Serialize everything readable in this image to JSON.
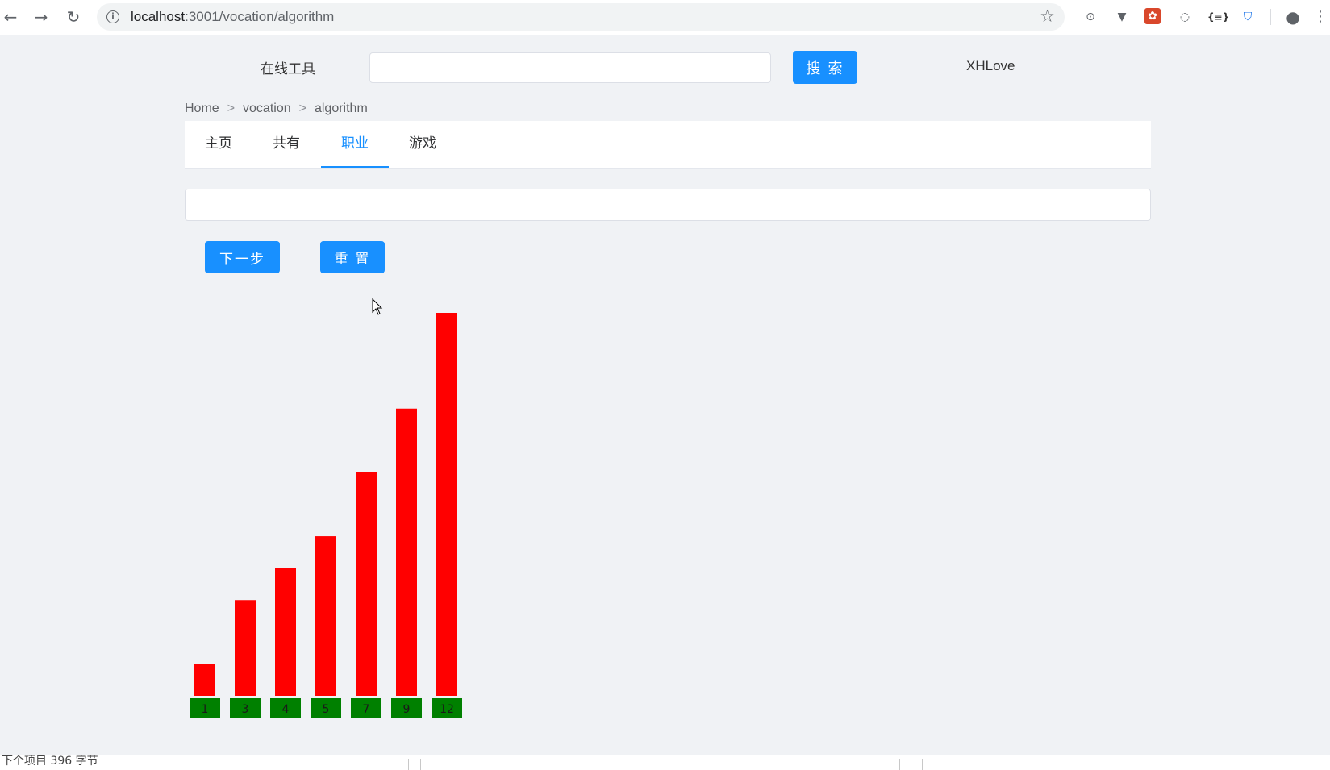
{
  "browser": {
    "url_host": "localhost",
    "url_rest": ":3001/vocation/algorithm",
    "icons": [
      "back-icon",
      "forward-icon",
      "reload-icon",
      "info-icon",
      "star-icon",
      "extension-icons",
      "profile-icon",
      "menu-icon"
    ]
  },
  "header": {
    "brand": "在线工具",
    "search_placeholder": "",
    "search_button": "搜 索",
    "user": "XHLove"
  },
  "breadcrumb": [
    "Home",
    "vocation",
    "algorithm"
  ],
  "breadcrumb_separator": ">",
  "tabs": [
    {
      "label": "主页",
      "active": false
    },
    {
      "label": "共有",
      "active": false
    },
    {
      "label": "职业",
      "active": true
    },
    {
      "label": "游戏",
      "active": false
    }
  ],
  "controls": {
    "input_value": "",
    "next_button": "下一步",
    "reset_button": "重 置"
  },
  "colors": {
    "primary": "#1890ff",
    "bar": "#ff0000",
    "label_box": "#008000"
  },
  "chart_data": {
    "type": "bar",
    "categories": [
      "1",
      "3",
      "4",
      "5",
      "7",
      "9",
      "12"
    ],
    "values": [
      1,
      3,
      4,
      5,
      7,
      9,
      12
    ],
    "title": "",
    "xlabel": "",
    "ylabel": ""
  },
  "status_bar": {
    "text": "下个项目 396 字节"
  }
}
